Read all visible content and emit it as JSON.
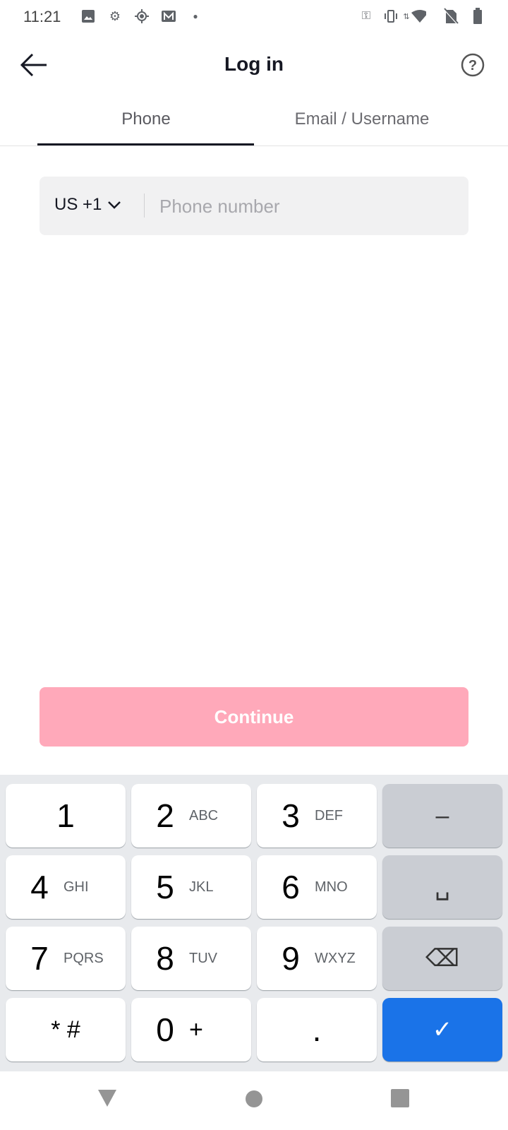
{
  "status_bar": {
    "time": "11:21",
    "left_icons": [
      "image-icon",
      "gear-icon",
      "location-icon",
      "gmail-icon",
      "dot-icon"
    ],
    "right_icons": [
      "vpn-key-icon",
      "vibrate-icon",
      "data-arrows-icon",
      "wifi-icon",
      "no-sim-icon",
      "battery-icon"
    ]
  },
  "header": {
    "title": "Log in",
    "back_icon": "arrow-left-icon",
    "help_icon": "help-circle-icon"
  },
  "tabs": [
    {
      "label": "Phone",
      "active": true
    },
    {
      "label": "Email / Username",
      "active": false
    }
  ],
  "phone_input": {
    "country_code": "US +1",
    "value": "",
    "placeholder": "Phone number"
  },
  "continue_label": "Continue",
  "colors": {
    "continue_disabled": "#FFA9BA",
    "keyboard_bg": "#E8EAED",
    "enter_key": "#1A73E8"
  },
  "keyboard": {
    "rows": [
      [
        {
          "d": "1",
          "l": ""
        },
        {
          "d": "2",
          "l": "ABC"
        },
        {
          "d": "3",
          "l": "DEF"
        },
        {
          "d": "–",
          "l": "",
          "type": "gray"
        }
      ],
      [
        {
          "d": "4",
          "l": "GHI"
        },
        {
          "d": "5",
          "l": "JKL"
        },
        {
          "d": "6",
          "l": "MNO"
        },
        {
          "d": "␣",
          "l": "",
          "type": "gray"
        }
      ],
      [
        {
          "d": "7",
          "l": "PQRS"
        },
        {
          "d": "8",
          "l": "TUV"
        },
        {
          "d": "9",
          "l": "WXYZ"
        },
        {
          "d": "⌫",
          "l": "",
          "type": "gray"
        }
      ],
      [
        {
          "d": "* #",
          "l": ""
        },
        {
          "d": "0",
          "l": "+"
        },
        {
          "d": ".",
          "l": ""
        },
        {
          "d": "✓",
          "l": "",
          "type": "blue"
        }
      ]
    ]
  },
  "nav_bar": [
    "back-triangle-icon",
    "home-circle-icon",
    "recents-square-icon"
  ]
}
